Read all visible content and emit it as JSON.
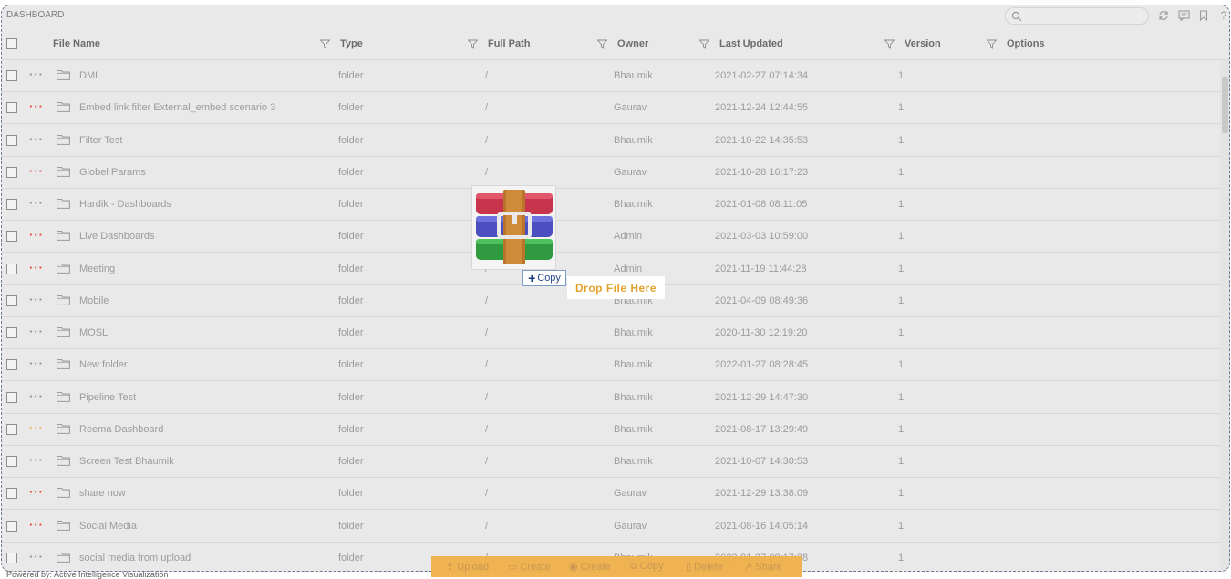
{
  "app": {
    "title": "DASHBOARD"
  },
  "search": {
    "placeholder": ""
  },
  "toolbar_icons": [
    "refresh-icon",
    "comment-icon",
    "bookmark-icon",
    "help-icon"
  ],
  "columns": [
    "File Name",
    "Type",
    "Full Path",
    "Owner",
    "Last Updated",
    "Version",
    "Options"
  ],
  "rows": [
    {
      "name": "DML",
      "type": "folder",
      "path": "/",
      "owner": "Bhaumik",
      "updated": "2021-02-27 07:14:34",
      "version": "1",
      "dots_color": "#8f8f8f"
    },
    {
      "name": "Embed link filter External_embed scenario 3",
      "type": "folder",
      "path": "/",
      "owner": "Gaurav",
      "updated": "2021-12-24 12:44:55",
      "version": "1",
      "dots_color": "#e8433c"
    },
    {
      "name": "Filter Test",
      "type": "folder",
      "path": "/",
      "owner": "Bhaumik",
      "updated": "2021-10-22 14:35:53",
      "version": "1",
      "dots_color": "#8f8f8f"
    },
    {
      "name": "Globel Params",
      "type": "folder",
      "path": "/",
      "owner": "Gaurav",
      "updated": "2021-10-28 16:17:23",
      "version": "1",
      "dots_color": "#e8433c"
    },
    {
      "name": "Hardik - Dashboards",
      "type": "folder",
      "path": "/",
      "owner": "Bhaumik",
      "updated": "2021-01-08 08:11:05",
      "version": "1",
      "dots_color": "#8f8f8f"
    },
    {
      "name": "Live Dashboards",
      "type": "folder",
      "path": "/",
      "owner": "Admin",
      "updated": "2021-03-03 10:59:00",
      "version": "1",
      "dots_color": "#e8433c"
    },
    {
      "name": "Meeting",
      "type": "folder",
      "path": "/",
      "owner": "Admin",
      "updated": "2021-11-19 11:44:28",
      "version": "1",
      "dots_color": "#e8433c"
    },
    {
      "name": "Mobile",
      "type": "folder",
      "path": "/",
      "owner": "Bhaumik",
      "updated": "2021-04-09 08:49:36",
      "version": "1",
      "dots_color": "#8f8f8f"
    },
    {
      "name": "MOSL",
      "type": "folder",
      "path": "/",
      "owner": "Bhaumik",
      "updated": "2020-11-30 12:19:20",
      "version": "1",
      "dots_color": "#8f8f8f"
    },
    {
      "name": "New folder",
      "type": "folder",
      "path": "/",
      "owner": "Bhaumik",
      "updated": "2022-01-27 08:28:45",
      "version": "1",
      "dots_color": "#8f8f8f"
    },
    {
      "name": "Pipeline Test",
      "type": "folder",
      "path": "/",
      "owner": "Bhaumik",
      "updated": "2021-12-29 14:47:30",
      "version": "1",
      "dots_color": "#8f8f8f"
    },
    {
      "name": "Reema Dashboard",
      "type": "folder",
      "path": "/",
      "owner": "Bhaumik",
      "updated": "2021-08-17 13:29:49",
      "version": "1",
      "dots_color": "#e0b23c"
    },
    {
      "name": "Screen Test Bhaumik",
      "type": "folder",
      "path": "/",
      "owner": "Bhaumik",
      "updated": "2021-10-07 14:30:53",
      "version": "1",
      "dots_color": "#8f8f8f"
    },
    {
      "name": "share now",
      "type": "folder",
      "path": "/",
      "owner": "Gaurav",
      "updated": "2021-12-29 13:38:09",
      "version": "1",
      "dots_color": "#e8433c"
    },
    {
      "name": "Social Media",
      "type": "folder",
      "path": "/",
      "owner": "Gaurav",
      "updated": "2021-08-16 14:05:14",
      "version": "1",
      "dots_color": "#e8433c"
    },
    {
      "name": "social media from upload",
      "type": "folder",
      "path": "/",
      "owner": "Bhaumik",
      "updated": "2022-01-27 08:17:38",
      "version": "1",
      "dots_color": "#8f8f8f"
    }
  ],
  "drag": {
    "copy_label": "Copy",
    "drop_label": "Drop File Here",
    "icon": "winrar-archive-icon"
  },
  "actions": [
    "Upload",
    "Create",
    "Create",
    "Copy",
    "Delete",
    "Share"
  ],
  "footer": {
    "powered_by": "Powered by: Active Intelligence Visualization"
  },
  "colors": {
    "accent": "#f0b14a",
    "drop_text": "#e3a32c"
  }
}
